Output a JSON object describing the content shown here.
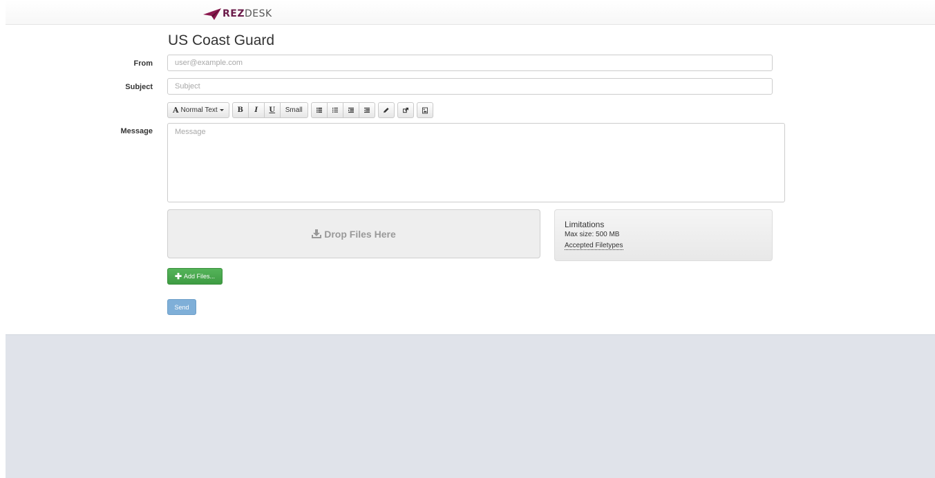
{
  "brand": {
    "logo_bold": "REZ",
    "logo_light": "DESK",
    "accent_color": "#8b1a4f"
  },
  "page": {
    "title": "US Coast Guard"
  },
  "form": {
    "from_label": "From",
    "from_placeholder": "user@example.com",
    "subject_label": "Subject",
    "subject_placeholder": "Subject",
    "message_label": "Message",
    "message_placeholder": "Message"
  },
  "toolbar": {
    "font_style_label": "Normal Text",
    "bold_label": "B",
    "italic_label": "I",
    "underline_label": "U",
    "small_label": "Small",
    "icons": [
      "unordered-list-icon",
      "ordered-list-icon",
      "outdent-icon",
      "indent-icon",
      "pencil-icon",
      "link-icon",
      "image-icon"
    ]
  },
  "upload": {
    "drop_label": "Drop Files Here",
    "limits_title": "Limitations",
    "limits_max_size": "Max size: 500 MB",
    "limits_link": "Accepted Filetypes",
    "add_files_label": "Add Files..."
  },
  "actions": {
    "send_label": "Send"
  }
}
